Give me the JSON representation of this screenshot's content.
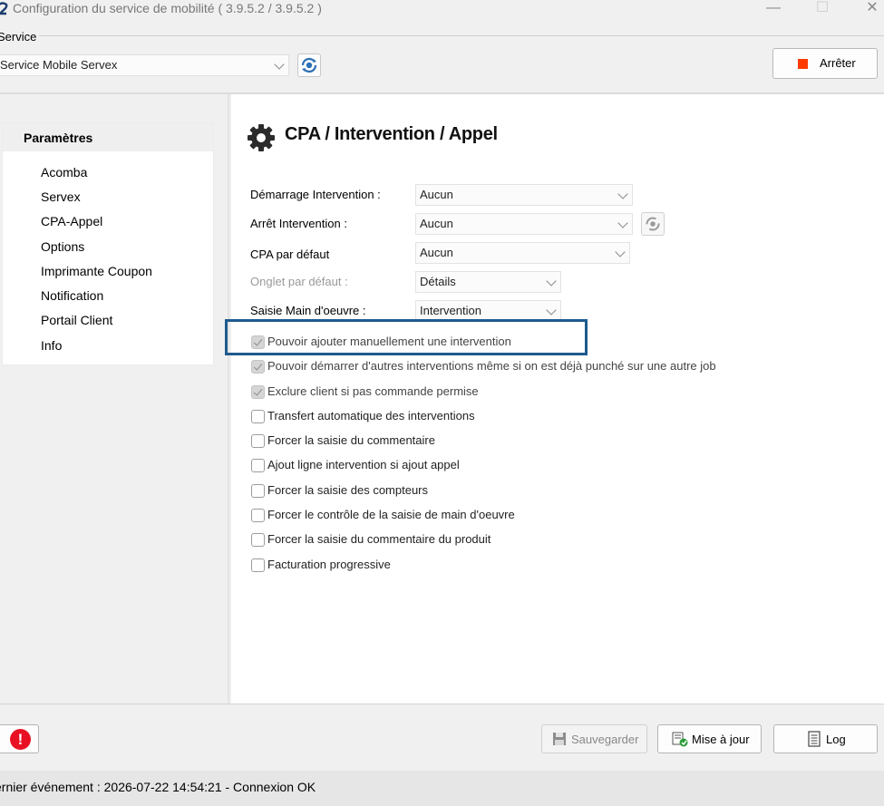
{
  "window": {
    "title": "Configuration du service de mobilité ( 3.9.5.2 / 3.9.5.2 )",
    "app_icon": "logo-icon",
    "minimize_glyph": "—",
    "maximize_glyph": "☐",
    "close_glyph": "✕"
  },
  "service": {
    "group_label": "Service",
    "selected": "Service Mobile Servex",
    "stop_label": "Arrêter",
    "stop_color": "#ff3a00"
  },
  "sidebar": {
    "header": "Paramètres",
    "items": [
      {
        "label": "Acomba"
      },
      {
        "label": "Servex"
      },
      {
        "label": "CPA-Appel"
      },
      {
        "label": "Options"
      },
      {
        "label": "Imprimante Coupon"
      },
      {
        "label": "Notification"
      },
      {
        "label": "Portail Client"
      },
      {
        "label": "Info"
      }
    ]
  },
  "content": {
    "title": "CPA / Intervention / Appel",
    "fields": [
      {
        "label": "Démarrage Intervention :",
        "value": "Aucun"
      },
      {
        "label": "Arrêt Intervention :",
        "value": "Aucun"
      },
      {
        "label": "CPA par défaut",
        "value": "Aucun"
      },
      {
        "label": "Onglet par défaut :",
        "value": "Détails"
      },
      {
        "label": "Saisie Main d'oeuvre :",
        "value": "Intervention"
      }
    ],
    "options": [
      {
        "label": "Pouvoir ajouter manuellement  une intervention",
        "checked": true
      },
      {
        "label": "Pouvoir démarrer d'autres interventions même si on est déjà punché sur une autre job",
        "checked": true
      },
      {
        "label": "Exclure client si pas commande permise",
        "checked": true
      },
      {
        "label": "Transfert automatique des interventions",
        "checked": false
      },
      {
        "label": "Forcer la saisie du commentaire",
        "checked": false
      },
      {
        "label": "Ajout ligne intervention si ajout appel",
        "checked": false
      },
      {
        "label": "Forcer la saisie des compteurs",
        "checked": false
      },
      {
        "label": "Forcer le contrôle de la saisie de main d'oeuvre",
        "checked": false
      },
      {
        "label": "Forcer la saisie du commentaire du produit",
        "checked": false
      },
      {
        "label": "Facturation progressive",
        "checked": false
      }
    ],
    "highlight_color": "#1e5a8d"
  },
  "footer": {
    "error_glyph": "!",
    "save_label": "Sauvegarder",
    "update_label": "Mise à jour",
    "log_label": "Log",
    "status": "ernier événement : 2026-07-22 14:54:21 - Connexion OK"
  }
}
